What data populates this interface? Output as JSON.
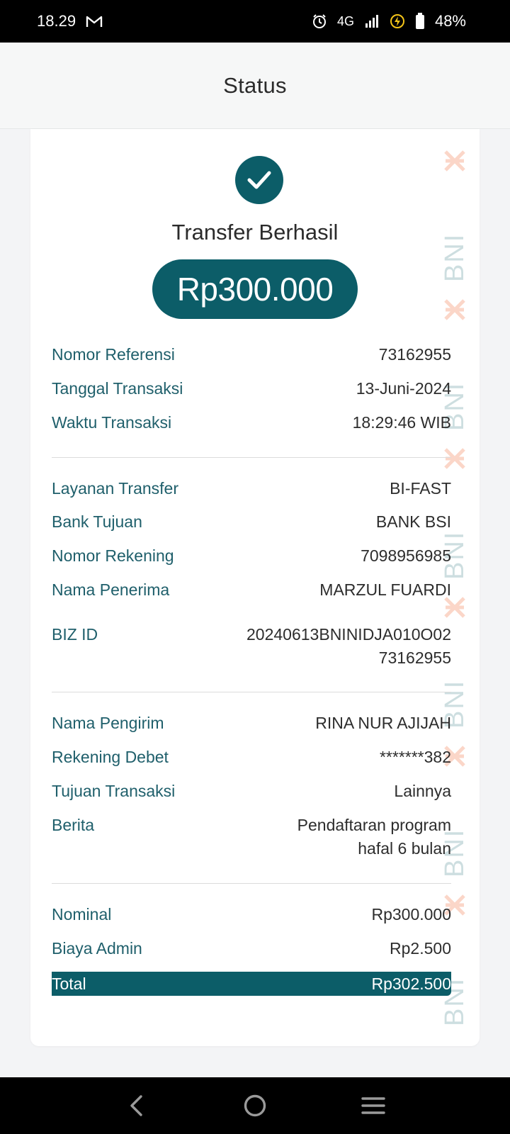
{
  "status_bar": {
    "time": "18.29",
    "network": "4G",
    "battery": "48%",
    "icons": [
      "gmail-icon",
      "alarm-icon",
      "signal-icon",
      "charging-icon",
      "battery-icon"
    ]
  },
  "header": {
    "title": "Status"
  },
  "receipt": {
    "status_title": "Transfer Berhasil",
    "amount": "Rp300.000",
    "watermark": "BNI",
    "accent_color": "#0c5d68",
    "section1": [
      {
        "label": "Nomor Referensi",
        "value": "73162955"
      },
      {
        "label": "Tanggal Transaksi",
        "value": "13-Juni-2024"
      },
      {
        "label": "Waktu Transaksi",
        "value": "18:29:46 WIB"
      }
    ],
    "section2": [
      {
        "label": "Layanan Transfer",
        "value": "BI-FAST"
      },
      {
        "label": "Bank Tujuan",
        "value": "BANK BSI"
      },
      {
        "label": "Nomor Rekening",
        "value": "7098956985"
      },
      {
        "label": "Nama Penerima",
        "value": "MARZUL FUARDI"
      },
      {
        "label": "BIZ ID",
        "value_line1": "20240613BNINIDJA010O02",
        "value_line2": "73162955"
      }
    ],
    "section3": [
      {
        "label": "Nama Pengirim",
        "value": "RINA NUR AJIJAH"
      },
      {
        "label": "Rekening Debet",
        "value": "*******382"
      },
      {
        "label": "Tujuan Transaksi",
        "value": "Lainnya"
      },
      {
        "label": "Berita",
        "value_line1": "Pendaftaran program",
        "value_line2": "hafal 6 bulan"
      }
    ],
    "section4": [
      {
        "label": "Nominal",
        "value": "Rp300.000"
      },
      {
        "label": "Biaya Admin",
        "value": "Rp2.500"
      }
    ],
    "total": {
      "label": "Total",
      "value": "Rp302.500"
    }
  },
  "nav": {
    "icons": [
      "back-icon",
      "home-icon",
      "menu-icon"
    ]
  }
}
